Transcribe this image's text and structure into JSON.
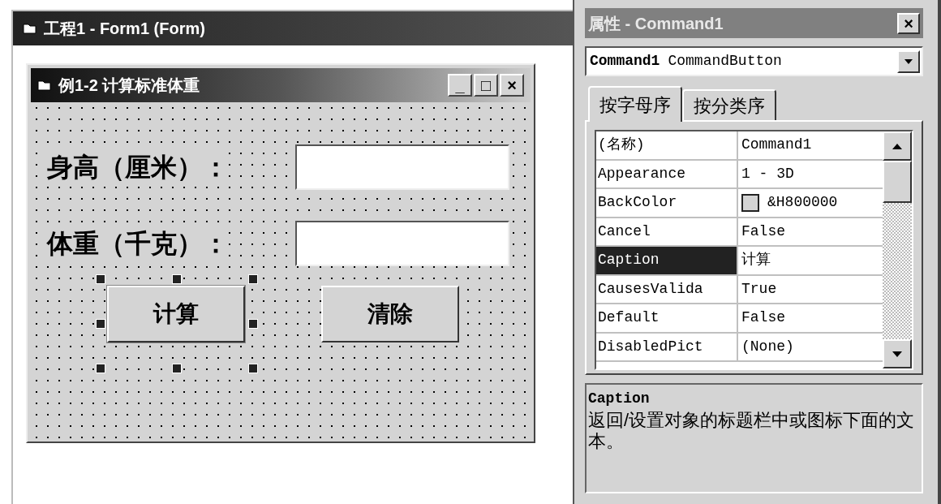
{
  "project_window": {
    "title": "工程1 - Form1 (Form)"
  },
  "form": {
    "title": "例1-2 计算标准体重",
    "title_buttons": [
      "_",
      "□",
      "×"
    ],
    "fields": [
      {
        "label": "身高（厘米）："
      },
      {
        "label": "体重（千克）："
      }
    ],
    "buttons": [
      {
        "caption": "计算",
        "selected": true
      },
      {
        "caption": "清除",
        "selected": false
      }
    ]
  },
  "properties": {
    "title": "属性 - Command1",
    "close": "×",
    "object": {
      "name": "Command1",
      "type": "CommandButton"
    },
    "tabs": [
      {
        "label": "按字母序",
        "selected": true
      },
      {
        "label": "按分类序",
        "selected": false
      }
    ],
    "rows": [
      {
        "kind": "text",
        "name": "(名称)",
        "value": "Command1",
        "selected": false
      },
      {
        "kind": "text",
        "name": "Appearance",
        "value": "1 - 3D",
        "selected": false
      },
      {
        "kind": "color",
        "name": "BackColor",
        "value": "&H800000",
        "selected": false
      },
      {
        "kind": "text",
        "name": "Cancel",
        "value": "False",
        "selected": false
      },
      {
        "kind": "text",
        "name": "Caption",
        "value": "计算",
        "selected": true
      },
      {
        "kind": "text",
        "name": "CausesValida",
        "value": "True",
        "selected": false
      },
      {
        "kind": "text",
        "name": "Default",
        "value": "False",
        "selected": false
      },
      {
        "kind": "text",
        "name": "DisabledPict",
        "value": "(None)",
        "selected": false
      }
    ],
    "description": {
      "title": "Caption",
      "text": "返回/设置对象的标题栏中或图标下面的文本。"
    }
  }
}
